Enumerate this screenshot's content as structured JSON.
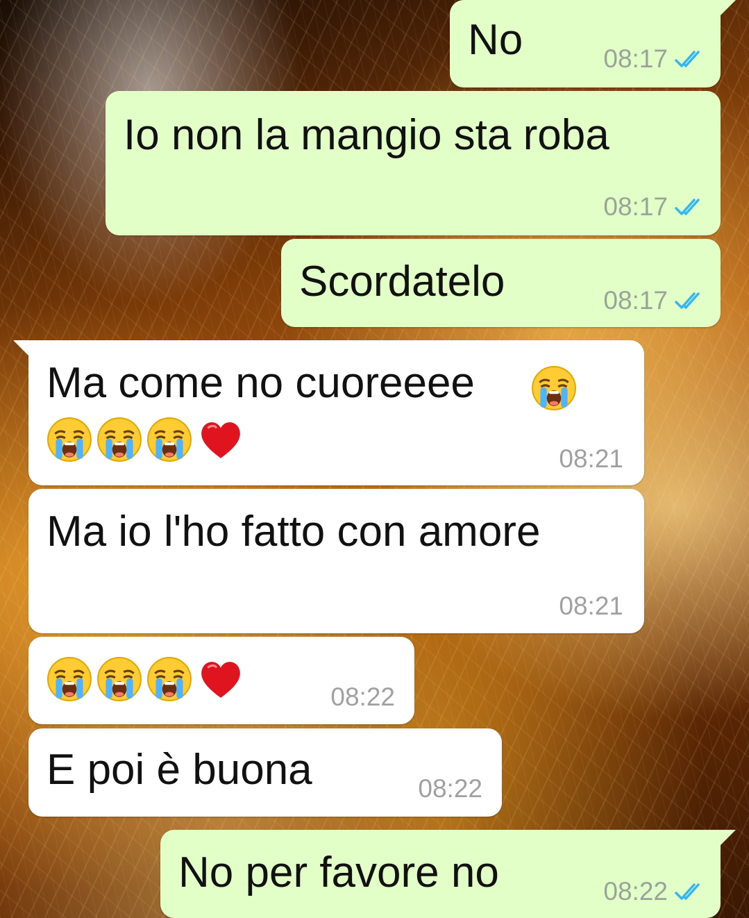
{
  "theme": {
    "outgoing_bubble": "#e2ffc7",
    "incoming_bubble": "#ffffff",
    "read_check": "#34b7f1",
    "timestamp": "#9aa39a"
  },
  "messages": [
    {
      "direction": "out",
      "text": "No",
      "time": "08:17",
      "status": "read"
    },
    {
      "direction": "out",
      "text": "Io non la mangio sta roba",
      "time": "08:17",
      "status": "read"
    },
    {
      "direction": "out",
      "text": "Scordatelo",
      "time": "08:17",
      "status": "read"
    },
    {
      "direction": "in",
      "text": "Ma come no cuoreeee",
      "emoji": [
        "loudly-crying-face",
        "loudly-crying-face",
        "loudly-crying-face",
        "loudly-crying-face",
        "red-heart"
      ],
      "time": "08:21"
    },
    {
      "direction": "in",
      "text": "Ma io l'ho fatto con amore",
      "time": "08:21"
    },
    {
      "direction": "in",
      "text": "",
      "emoji": [
        "loudly-crying-face",
        "loudly-crying-face",
        "loudly-crying-face",
        "red-heart"
      ],
      "time": "08:22"
    },
    {
      "direction": "in",
      "text": "E poi è buona",
      "time": "08:22"
    },
    {
      "direction": "out",
      "text": "No per favore no",
      "time": "08:22",
      "status": "read"
    }
  ]
}
